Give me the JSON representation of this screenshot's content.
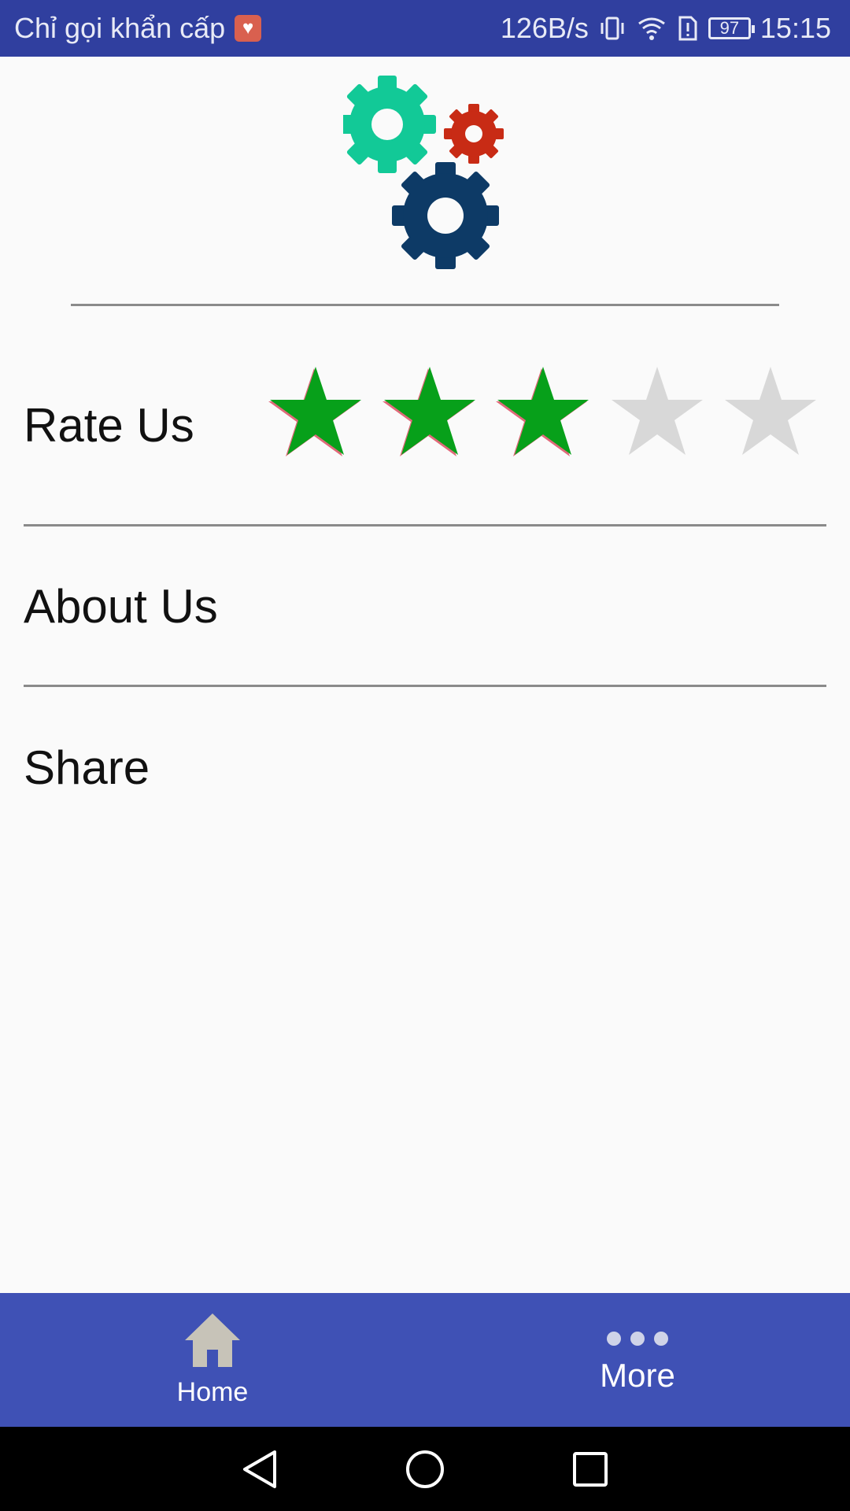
{
  "status_bar": {
    "left_text": "Chỉ gọi khẩn cấp",
    "speed": "126B/s",
    "battery": "97",
    "time": "15:15",
    "icons": [
      "emergency-heart-icon",
      "vibrate-icon",
      "wifi-icon",
      "sim-alert-icon",
      "battery-icon"
    ]
  },
  "logo": {
    "name": "gears-logo"
  },
  "settings": {
    "rate": {
      "label": "Rate Us",
      "rating": 3,
      "max": 5,
      "filled_color": "#07a01a",
      "empty_color": "#d8d8d8"
    },
    "about": {
      "label": "About Us"
    },
    "share": {
      "label": "Share"
    }
  },
  "bottom_nav": {
    "home": {
      "label": "Home",
      "icon": "home-icon"
    },
    "more": {
      "label": "More",
      "icon": "more-dots-icon"
    },
    "background": "#3f51b5"
  },
  "system_nav": {
    "icons": [
      "back-icon",
      "home-circle-icon",
      "recents-icon"
    ]
  }
}
